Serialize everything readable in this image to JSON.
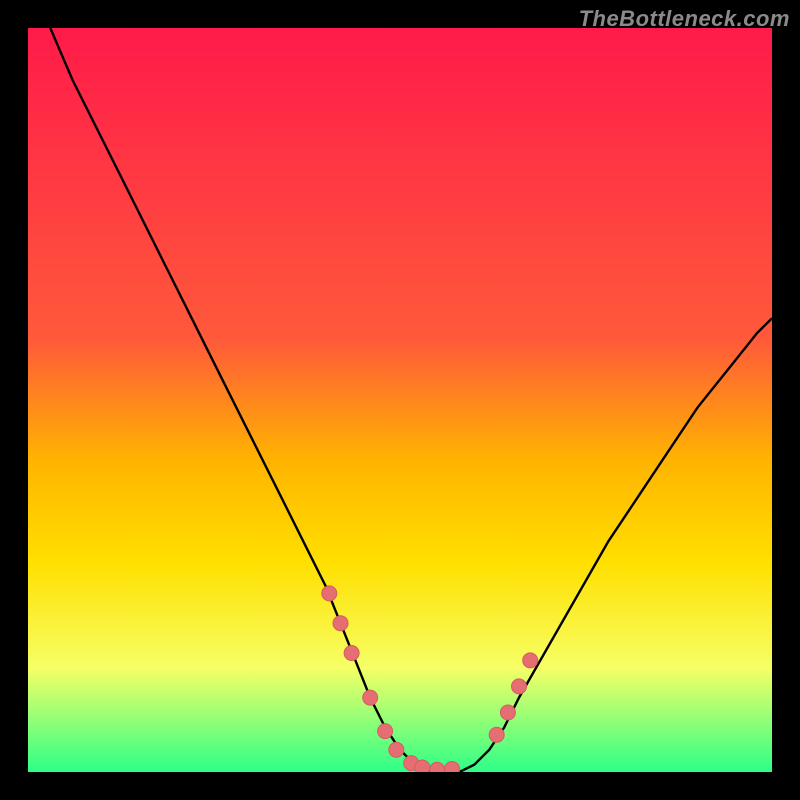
{
  "watermark": "TheBottleneck.com",
  "colors": {
    "top": "#ff1a4a",
    "mid1": "#ff5a3a",
    "mid2": "#ffb300",
    "mid3": "#ffe000",
    "mid4": "#f6ff66",
    "bottom": "#2dff87",
    "curve": "#000000",
    "marker_fill": "#e46e72",
    "marker_stroke": "#d85a60",
    "frame": "#000000"
  },
  "chart_data": {
    "type": "line",
    "title": "",
    "xlabel": "",
    "ylabel": "",
    "xlim": [
      0,
      100
    ],
    "ylim": [
      0,
      100
    ],
    "curve": {
      "name": "bottleneck-curve",
      "x": [
        3,
        6,
        10,
        14,
        18,
        22,
        26,
        30,
        34,
        38,
        40,
        42,
        44,
        46,
        48,
        50,
        52,
        54,
        56,
        58,
        60,
        62,
        64,
        66,
        70,
        74,
        78,
        82,
        86,
        90,
        94,
        98,
        100
      ],
      "y": [
        100,
        93,
        85,
        77,
        69,
        61,
        53,
        45,
        37,
        29,
        25,
        20,
        15,
        10,
        6,
        3,
        1,
        0,
        0,
        0,
        1,
        3,
        6,
        10,
        17,
        24,
        31,
        37,
        43,
        49,
        54,
        59,
        61
      ]
    },
    "markers": {
      "name": "highlight-points",
      "x": [
        40.5,
        42,
        43.5,
        46,
        48,
        49.5,
        51.5,
        53,
        55,
        57,
        63,
        64.5,
        66,
        67.5
      ],
      "y": [
        24,
        20,
        16,
        10,
        5.5,
        3,
        1.2,
        0.6,
        0.3,
        0.4,
        5,
        8,
        11.5,
        15
      ]
    },
    "gradient_stops": [
      {
        "offset": 0,
        "key": "top"
      },
      {
        "offset": 42,
        "key": "mid1"
      },
      {
        "offset": 58,
        "key": "mid2"
      },
      {
        "offset": 72,
        "key": "mid3"
      },
      {
        "offset": 86,
        "key": "mid4"
      },
      {
        "offset": 100,
        "key": "bottom"
      }
    ]
  }
}
